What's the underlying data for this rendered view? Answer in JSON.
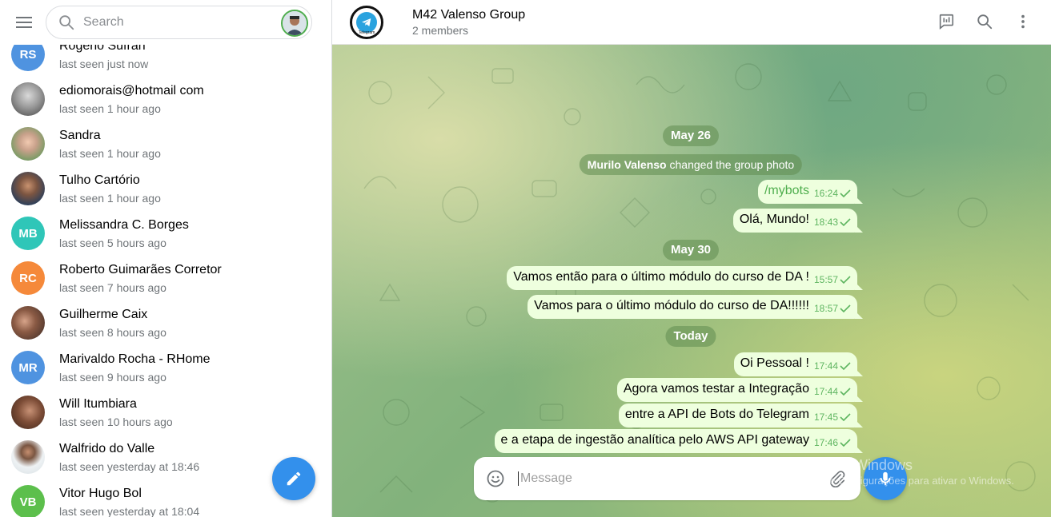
{
  "sidebar": {
    "search_placeholder": "Search",
    "chats": [
      {
        "initials": "RS",
        "name": "Rogério Sufran",
        "status": "last seen just now",
        "color": "#4f93e0"
      },
      {
        "initials": "",
        "name": "ediomorais@hotmail com",
        "status": "last seen 1 hour ago",
        "color": "#8a8a8a"
      },
      {
        "initials": "",
        "name": "Sandra",
        "status": "last seen 1 hour ago",
        "color": "#9cae7a"
      },
      {
        "initials": "",
        "name": "Tulho Cartório",
        "status": "last seen 1 hour ago",
        "color": "#6d7f95"
      },
      {
        "initials": "MB",
        "name": "Melissandra C. Borges",
        "status": "last seen 5 hours ago",
        "color": "#2fc6b8"
      },
      {
        "initials": "RC",
        "name": "Roberto Guimarães Corretor",
        "status": "last seen 7 hours ago",
        "color": "#f5893a"
      },
      {
        "initials": "",
        "name": "Guilherme Caix",
        "status": "last seen 8 hours ago",
        "color": "#a06a52"
      },
      {
        "initials": "MR",
        "name": "Marivaldo Rocha - RHome",
        "status": "last seen 9 hours ago",
        "color": "#4f93e0"
      },
      {
        "initials": "",
        "name": "Will Itumbiara",
        "status": "last seen 10 hours ago",
        "color": "#8b5a43"
      },
      {
        "initials": "",
        "name": "Walfrido do Valle",
        "status": "last seen yesterday at 18:46",
        "color": "#cfd8dc"
      },
      {
        "initials": "VB",
        "name": "Vitor Hugo Bol",
        "status": "last seen yesterday at 18:04",
        "color": "#5cbf4c"
      }
    ]
  },
  "header": {
    "title": "M42 Valenso Group",
    "subtitle": "2 members",
    "avatar_text": "Telegram"
  },
  "messages": {
    "date1": "May 26",
    "service_name": "Murilo Valenso",
    "service_text": " changed the group photo",
    "m1": {
      "text": "/mybots",
      "time": "16:24"
    },
    "m2": {
      "text": "Olá, Mundo!",
      "time": "18:43"
    },
    "date2": "May 30",
    "m3": {
      "text": "Vamos então para o último módulo do curso de DA !",
      "time": "15:57"
    },
    "m4": {
      "text": "Vamos para o último módulo do curso de DA!!!!!!",
      "time": "18:57"
    },
    "date3": "Today",
    "m5": {
      "text": "Oi Pessoal !",
      "time": "17:44"
    },
    "m6": {
      "text": "Agora vamos testar a Integração",
      "time": "17:44"
    },
    "m7": {
      "text": "entre a API de Bots do Telegram",
      "time": "17:45"
    },
    "m8": {
      "text": "e a etapa de ingestão analítica pelo AWS API gateway",
      "time": "17:46"
    }
  },
  "composer": {
    "placeholder": "Message"
  },
  "watermark": {
    "line1": "Ativar o Windows",
    "line2": "Acesse Configurações para ativar o Windows."
  },
  "colors": {
    "accent": "#3390ec",
    "bubble": "#eeffde",
    "check": "#5eb560"
  },
  "icons": [
    "menu-icon",
    "search-icon",
    "pencil-icon",
    "poll-icon",
    "dots-vertical-icon",
    "emoji-icon",
    "paperclip-icon",
    "microphone-icon",
    "check-icon"
  ]
}
